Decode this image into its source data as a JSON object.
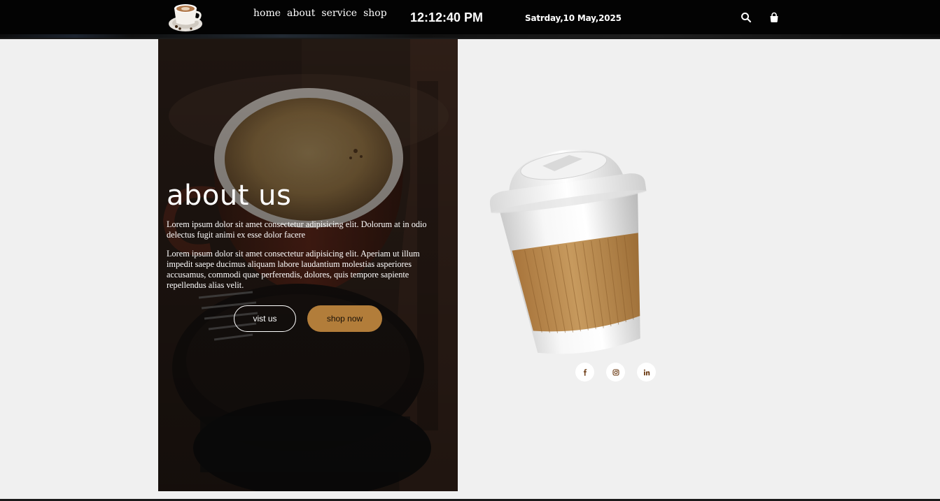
{
  "header": {
    "logo_icon": "coffee-cup-logo",
    "nav": [
      "home",
      "about",
      "service",
      "shop"
    ],
    "clock": "12:12:40 PM",
    "date": "Satrday,10 May,2025",
    "search_icon": "search-icon",
    "bag_icon": "shopping-bag-icon"
  },
  "hero": {
    "title": "about us",
    "paragraph1": "Lorem ipsum dolor sit amet consectetur adipisicing elit. Dolorum at in odio delectus fugit animi ex esse dolor facere",
    "paragraph2": "Lorem ipsum dolor sit amet consectetur adipisicing elit. Aperiam ut illum impedit saepe ducimus aliquam labore laudantium molestias asperiores accusamus, commodi quae perferendis, dolores, quis tempore sapiente repellendus alias velit.",
    "visit_button": "vist us",
    "shop_button": "shop now"
  },
  "socials": [
    {
      "icon": "facebook-icon"
    },
    {
      "icon": "instagram-icon"
    },
    {
      "icon": "linkedin-icon"
    }
  ],
  "colors": {
    "header_bg": "#030303",
    "page_bg": "#f0f0f0",
    "accent": "#b27d3a",
    "icon_brown": "#6b3a12"
  }
}
